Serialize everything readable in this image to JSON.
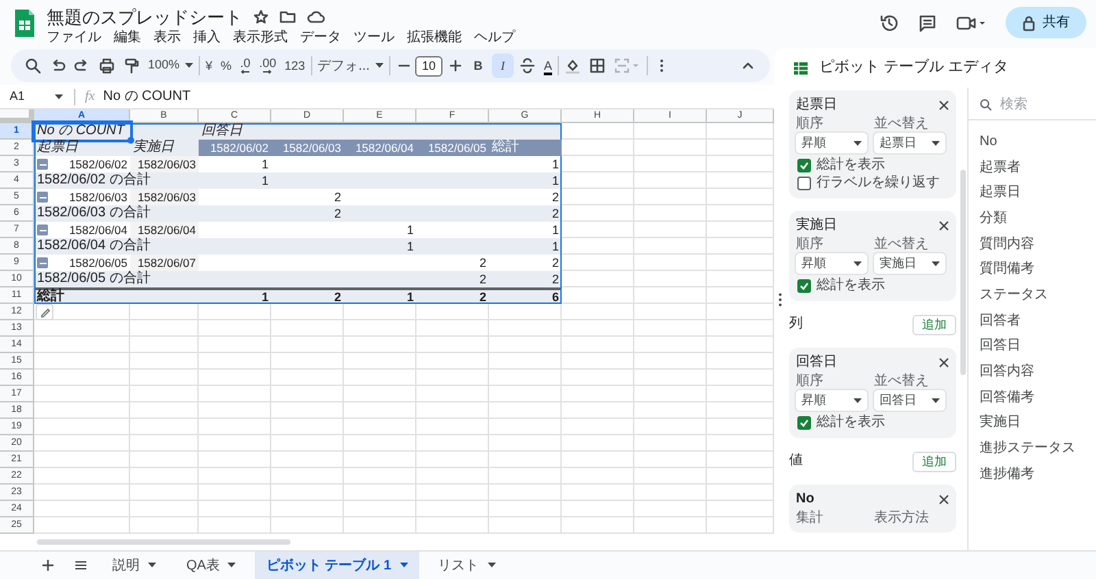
{
  "document": {
    "title": "無題のスプレッドシート"
  },
  "menu": [
    "ファイル",
    "編集",
    "表示",
    "挿入",
    "表示形式",
    "データ",
    "ツール",
    "拡張機能",
    "ヘルプ"
  ],
  "share_button": "共有",
  "toolbar": {
    "zoom": "100%",
    "currency": "¥",
    "percent": "%",
    "decimal_decrease": ".0",
    "decimal_increase": ".00",
    "number_format": "123",
    "font": "デフォ...",
    "font_size": "10",
    "text_color": "A",
    "format_buttons": [
      {
        "label": "B",
        "selected": false
      },
      {
        "label": "I",
        "selected": true
      }
    ]
  },
  "formula_bar": {
    "name_box": "A1",
    "fx": "fx",
    "formula": "No の COUNT"
  },
  "grid": {
    "columns": [
      {
        "label": "A",
        "selected": true
      },
      {
        "label": "B",
        "selected": false
      },
      {
        "label": "C",
        "selected": false
      },
      {
        "label": "D",
        "selected": false
      },
      {
        "label": "E",
        "selected": false
      },
      {
        "label": "F",
        "selected": false
      },
      {
        "label": "G",
        "selected": false
      },
      {
        "label": "H",
        "selected": false
      },
      {
        "label": "I",
        "selected": false
      },
      {
        "label": "J",
        "selected": false
      }
    ],
    "row_numbers": [
      {
        "label": "1",
        "selected": true
      },
      {
        "label": "2",
        "selected": false
      },
      {
        "label": "3",
        "selected": false
      },
      {
        "label": "4",
        "selected": false
      },
      {
        "label": "5",
        "selected": false
      },
      {
        "label": "6",
        "selected": false
      },
      {
        "label": "7",
        "selected": false
      },
      {
        "label": "8",
        "selected": false
      },
      {
        "label": "9",
        "selected": false
      },
      {
        "label": "10",
        "selected": false
      },
      {
        "label": "11",
        "selected": false
      },
      {
        "label": "12",
        "selected": false
      },
      {
        "label": "13",
        "selected": false
      },
      {
        "label": "14",
        "selected": false
      },
      {
        "label": "15",
        "selected": false
      },
      {
        "label": "16",
        "selected": false
      },
      {
        "label": "17",
        "selected": false
      },
      {
        "label": "18",
        "selected": false
      },
      {
        "label": "19",
        "selected": false
      },
      {
        "label": "20",
        "selected": false
      },
      {
        "label": "21",
        "selected": false
      },
      {
        "label": "22",
        "selected": false
      },
      {
        "label": "23",
        "selected": false
      },
      {
        "label": "24",
        "selected": false
      },
      {
        "label": "25",
        "selected": false
      }
    ],
    "pivot_rows": [
      {
        "kind": "value_header",
        "cells": {
          "A": "No の COUNT",
          "C": "回答日"
        }
      },
      {
        "kind": "column_header",
        "cells": {
          "A": "起票日",
          "B": "実施日",
          "C": "1582/06/02",
          "D": "1582/06/03",
          "E": "1582/06/04",
          "F": "1582/06/05",
          "G": "総計"
        }
      },
      {
        "kind": "group",
        "cells": {
          "A": "1582/06/02",
          "B": "1582/06/03",
          "C": "1",
          "G": "1"
        }
      },
      {
        "kind": "subtotal",
        "cells": {
          "A": "1582/06/02 の合計",
          "C": "1",
          "G": "1"
        }
      },
      {
        "kind": "group",
        "cells": {
          "A": "1582/06/03",
          "B": "1582/06/03",
          "D": "2",
          "G": "2"
        }
      },
      {
        "kind": "subtotal",
        "cells": {
          "A": "1582/06/03 の合計",
          "D": "2",
          "G": "2"
        }
      },
      {
        "kind": "group",
        "cells": {
          "A": "1582/06/04",
          "B": "1582/06/04",
          "E": "1",
          "G": "1"
        }
      },
      {
        "kind": "subtotal",
        "cells": {
          "A": "1582/06/04 の合計",
          "E": "1",
          "G": "1"
        }
      },
      {
        "kind": "group",
        "cells": {
          "A": "1582/06/05",
          "B": "1582/06/07",
          "F": "2",
          "G": "2"
        }
      },
      {
        "kind": "subtotal",
        "cells": {
          "A": "1582/06/05 の合計",
          "F": "2",
          "G": "2"
        }
      },
      {
        "kind": "total",
        "cells": {
          "A": "総計",
          "C": "1",
          "D": "2",
          "E": "1",
          "F": "2",
          "G": "6"
        }
      }
    ]
  },
  "pivot_editor": {
    "title": "ピボット テーブル エディタ",
    "search_placeholder": "検索",
    "sections": [
      {
        "cards": [
          {
            "kind": "group",
            "name": "起票日",
            "order_label": "順序",
            "order": "昇順",
            "sort_label": "並べ替え",
            "sort_by": "起票日",
            "options": [
              {
                "label": "総計を表示",
                "checked": true
              },
              {
                "label": "行ラベルを繰り返す",
                "checked": false
              }
            ]
          },
          {
            "kind": "group",
            "name": "実施日",
            "order_label": "順序",
            "order": "昇順",
            "sort_label": "並べ替え",
            "sort_by": "実施日",
            "options": [
              {
                "label": "総計を表示",
                "checked": true
              }
            ]
          }
        ]
      },
      {
        "label": "列",
        "add_button": "追加",
        "cards": [
          {
            "kind": "group",
            "name": "回答日",
            "order_label": "順序",
            "order": "昇順",
            "sort_label": "並べ替え",
            "sort_by": "回答日",
            "options": [
              {
                "label": "総計を表示",
                "checked": true
              }
            ]
          }
        ]
      },
      {
        "label": "値",
        "add_button": "追加",
        "cards": [
          {
            "kind": "value",
            "name": "No",
            "summarize_label": "集計",
            "show_as_label": "表示方法"
          }
        ]
      }
    ],
    "fields": [
      "No",
      "起票者",
      "起票日",
      "分類",
      "質問内容",
      "質問備考",
      "ステータス",
      "回答者",
      "回答日",
      "回答内容",
      "回答備考",
      "実施日",
      "進捗ステータス",
      "進捗備考"
    ]
  },
  "sheet_tabs": [
    {
      "label": "説明",
      "selected": false
    },
    {
      "label": "QA表",
      "selected": false
    },
    {
      "label": "ピボット テーブル 1",
      "selected": true
    },
    {
      "label": "リスト",
      "selected": false
    }
  ]
}
